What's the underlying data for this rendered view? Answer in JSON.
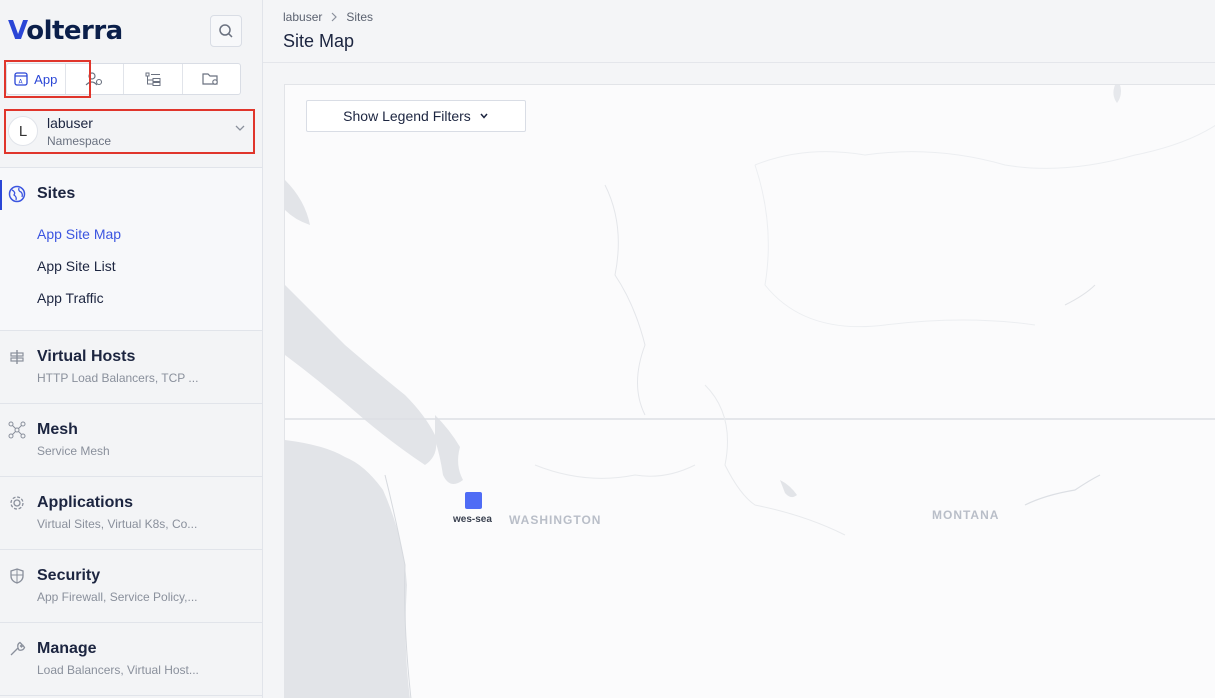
{
  "brand": {
    "name_v": "V",
    "name_rest": "olterra"
  },
  "tabs": [
    {
      "label": "App",
      "icon": "app-icon"
    },
    {
      "label": "",
      "icon": "users-icon"
    },
    {
      "label": "",
      "icon": "hierarchy-icon"
    },
    {
      "label": "",
      "icon": "folder-settings-icon"
    }
  ],
  "namespace": {
    "avatar": "L",
    "name": "labuser",
    "label": "Namespace"
  },
  "sidebar": {
    "sections": [
      {
        "title": "Sites",
        "icon": "globe-icon",
        "links": [
          "App Site Map",
          "App Site List",
          "App Traffic"
        ],
        "active_link": "App Site Map"
      },
      {
        "title": "Virtual Hosts",
        "icon": "virtual-hosts-icon",
        "desc": "HTTP Load Balancers, TCP ..."
      },
      {
        "title": "Mesh",
        "icon": "mesh-icon",
        "desc": "Service Mesh"
      },
      {
        "title": "Applications",
        "icon": "gear-icon",
        "desc": "Virtual Sites, Virtual K8s, Co..."
      },
      {
        "title": "Security",
        "icon": "shield-icon",
        "desc": "App Firewall, Service Policy,..."
      },
      {
        "title": "Manage",
        "icon": "wrench-icon",
        "desc": "Load Balancers, Virtual Host..."
      }
    ]
  },
  "header": {
    "breadcrumb": [
      "labuser",
      "Sites"
    ],
    "title": "Site Map"
  },
  "map": {
    "legend_button": "Show Legend Filters",
    "site": {
      "name": "wes-sea"
    },
    "regions": [
      "WASHINGTON",
      "MONTANA"
    ]
  },
  "colors": {
    "accent": "#2a46d6",
    "marker": "#4f6cf5",
    "highlight": "#e0352b"
  }
}
